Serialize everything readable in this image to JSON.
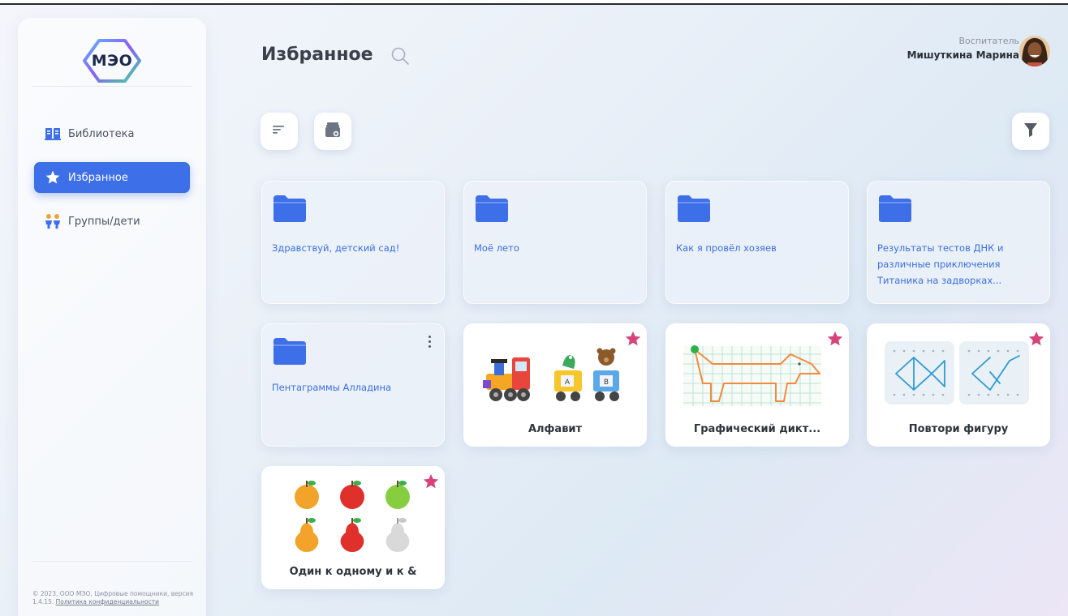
{
  "brand": {
    "logo_text": "МЭО"
  },
  "sidebar": {
    "items": [
      {
        "label": "Библиотека",
        "icon": "book-icon",
        "active": false
      },
      {
        "label": "Избранное",
        "icon": "star-icon",
        "active": true
      },
      {
        "label": "Группы/дети",
        "icon": "children-icon",
        "active": false
      }
    ],
    "footer": {
      "text": "© 2023, ООО МЭО, Цифровые помощники, версия 1.4.15.",
      "link": "Политика конфиденциальности"
    }
  },
  "header": {
    "title": "Избранное",
    "search_icon": "search-icon",
    "user_role": "Воспитатель",
    "user_name": "Мишуткина Марина"
  },
  "toolbar": {
    "sort_icon": "sort-icon",
    "add_folder_icon": "add-folder-icon",
    "filter_icon": "filter-icon"
  },
  "colors": {
    "accent": "#3d6fe8",
    "folder": "#3d6fe8",
    "star": "#d6457a"
  },
  "folders": [
    {
      "label": "Здравствуй, детский сад!"
    },
    {
      "label": "Моё лето"
    },
    {
      "label": "Как я провёл хозяев"
    },
    {
      "label": "Результаты тестов ДНК и различные приключения Титаника на задворках..."
    },
    {
      "label": "Пентаграммы Алладина"
    }
  ],
  "games": [
    {
      "label": "Алфавит",
      "icon": "train-picture",
      "favorite": true
    },
    {
      "label": "Графический дикт...",
      "icon": "grid-dog-picture",
      "favorite": true
    },
    {
      "label": "Повтори фигуру",
      "icon": "dot-fish-picture",
      "favorite": true
    },
    {
      "label": "Один к одному и к &",
      "icon": "fruits-picture",
      "favorite": true
    },
    {
      "letters": [
        "А",
        "В"
      ]
    }
  ]
}
